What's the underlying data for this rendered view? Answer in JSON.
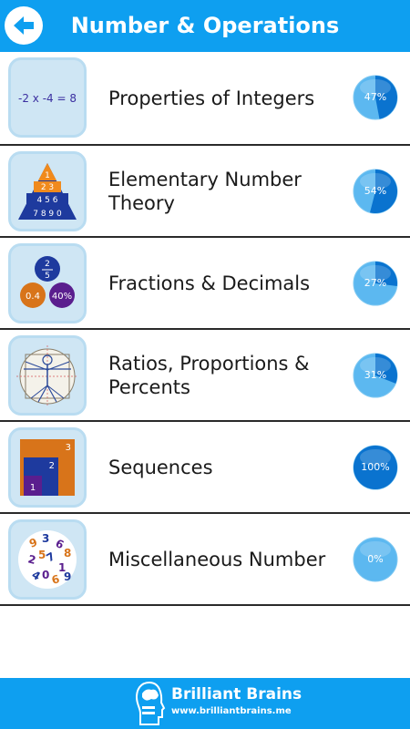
{
  "header": {
    "title": "Number & Operations",
    "back_icon": "back-arrow-icon",
    "color": "#0e9ff0"
  },
  "topics": [
    {
      "label": "Properties of Integers",
      "progress": 47,
      "progress_text": "47%",
      "icon": "integer-equation-icon",
      "icon_text": "-2 x -4 = 8"
    },
    {
      "label": "Elementary Number Theory",
      "progress": 54,
      "progress_text": "54%",
      "icon": "number-pyramid-icon",
      "icon_text": [
        "1",
        "2 3",
        "4 5 6",
        "7 8 9 0"
      ]
    },
    {
      "label": "Fractions & Decimals",
      "progress": 27,
      "progress_text": "27%",
      "icon": "fraction-circles-icon",
      "icon_text": [
        "2",
        "5",
        "0.4",
        "40%"
      ]
    },
    {
      "label": "Ratios, Proportions & Percents",
      "progress": 31,
      "progress_text": "31%",
      "icon": "vitruvian-man-icon"
    },
    {
      "label": "Sequences",
      "progress": 100,
      "progress_text": "100%",
      "icon": "nested-squares-icon",
      "icon_text": [
        "1",
        "2",
        "3"
      ]
    },
    {
      "label": "Miscellaneous Number",
      "progress": 0,
      "progress_text": "0%",
      "icon": "number-jumble-icon"
    }
  ],
  "footer": {
    "brand": "Brilliant Brains",
    "url": "www.brilliantbrains.me",
    "logo_icon": "brain-head-icon"
  },
  "colors": {
    "accent": "#0e9ff0",
    "progress_fill": "#0a73cf",
    "progress_light": "#5cb8f0"
  }
}
